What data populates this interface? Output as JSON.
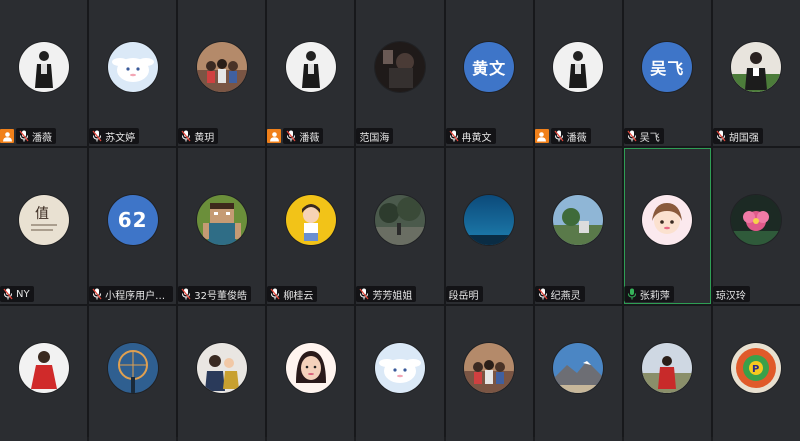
{
  "participants": [
    {
      "name": "潘薇",
      "avatar_text": "",
      "avatar_icon": "photo-man-black-suit",
      "host": true,
      "mic": "muted",
      "active": false
    },
    {
      "name": "苏文婷",
      "avatar_text": "",
      "avatar_icon": "cartoon-cinnamoroll",
      "host": false,
      "mic": "muted",
      "active": false
    },
    {
      "name": "黄玥",
      "avatar_text": "",
      "avatar_icon": "photo-group",
      "host": false,
      "mic": "muted",
      "active": false
    },
    {
      "name": "潘薇",
      "avatar_text": "",
      "avatar_icon": "photo-man-black-suit",
      "host": true,
      "mic": "muted",
      "active": false
    },
    {
      "name": "范国海",
      "avatar_text": "",
      "avatar_icon": "photo-dark",
      "host": false,
      "mic": "none",
      "active": false
    },
    {
      "name": "冉黄文",
      "avatar_text": "黄文",
      "avatar_icon": "",
      "host": false,
      "mic": "muted",
      "active": false
    },
    {
      "name": "潘薇",
      "avatar_text": "",
      "avatar_icon": "photo-man-black-suit",
      "host": true,
      "mic": "muted",
      "active": false
    },
    {
      "name": "吴飞",
      "avatar_text": "吴飞",
      "avatar_icon": "",
      "host": false,
      "mic": "muted",
      "active": false
    },
    {
      "name": "胡国强",
      "avatar_text": "",
      "avatar_icon": "photo-man-green",
      "host": false,
      "mic": "muted",
      "active": false
    },
    {
      "name": "NY",
      "avatar_text": "",
      "avatar_icon": "calligraphy",
      "host": false,
      "mic": "muted",
      "active": false
    },
    {
      "name": "小程序用户PM…",
      "avatar_text": "62",
      "avatar_icon": "",
      "host": false,
      "mic": "muted",
      "active": false
    },
    {
      "name": "32号董俊皓",
      "avatar_text": "",
      "avatar_icon": "minecraft-character",
      "host": false,
      "mic": "muted",
      "active": false
    },
    {
      "name": "柳桂云",
      "avatar_text": "",
      "avatar_icon": "cartoon-girl-yellow",
      "host": false,
      "mic": "muted",
      "active": false
    },
    {
      "name": "芳芳姐姐",
      "avatar_text": "",
      "avatar_icon": "photo-forest",
      "host": false,
      "mic": "muted",
      "active": false
    },
    {
      "name": "段岳明",
      "avatar_text": "",
      "avatar_icon": "photo-blue-sky",
      "host": false,
      "mic": "none",
      "active": false
    },
    {
      "name": "纪燕灵",
      "avatar_text": "",
      "avatar_icon": "photo-landscape",
      "host": false,
      "mic": "muted",
      "active": false
    },
    {
      "name": "张莉萍",
      "avatar_text": "",
      "avatar_icon": "cartoon-girl-pink",
      "host": false,
      "mic": "on",
      "active": true
    },
    {
      "name": "琼汉玲",
      "avatar_text": "",
      "avatar_icon": "photo-pink-flower",
      "host": false,
      "mic": "none",
      "active": false
    },
    {
      "name": "",
      "avatar_text": "",
      "avatar_icon": "photo-woman-red",
      "host": false,
      "mic": "none",
      "active": false
    },
    {
      "name": "",
      "avatar_text": "",
      "avatar_icon": "photo-ferris-wheel",
      "host": false,
      "mic": "none",
      "active": false
    },
    {
      "name": "",
      "avatar_text": "",
      "avatar_icon": "photo-family",
      "host": false,
      "mic": "none",
      "active": false
    },
    {
      "name": "",
      "avatar_text": "",
      "avatar_icon": "photo-woman-portrait",
      "host": false,
      "mic": "none",
      "active": false
    },
    {
      "name": "",
      "avatar_text": "",
      "avatar_icon": "cartoon-cinnamoroll",
      "host": false,
      "mic": "none",
      "active": false
    },
    {
      "name": "",
      "avatar_text": "",
      "avatar_icon": "photo-group",
      "host": false,
      "mic": "none",
      "active": false
    },
    {
      "name": "",
      "avatar_text": "",
      "avatar_icon": "photo-mountain",
      "host": false,
      "mic": "none",
      "active": false
    },
    {
      "name": "",
      "avatar_text": "",
      "avatar_icon": "photo-woman-outdoor",
      "host": false,
      "mic": "none",
      "active": false
    },
    {
      "name": "",
      "avatar_text": "",
      "avatar_icon": "colorful-logo",
      "host": false,
      "mic": "none",
      "active": false
    }
  ],
  "colors": {
    "tile_bg": "#2b2d31",
    "text_avatar_bg": "#3e75c8",
    "host_badge": "#f0801a",
    "active_outline": "#2f9e55",
    "mic_on": "#36b35a",
    "mic_muted": "#ffffff"
  }
}
